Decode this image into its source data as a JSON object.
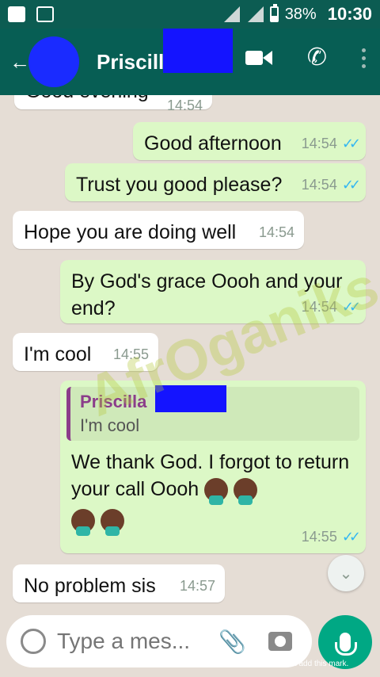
{
  "status_bar": {
    "battery": "38%",
    "time": "10:30"
  },
  "header": {
    "contact_name": "Priscilla"
  },
  "messages": [
    {
      "text": "Good evening",
      "time": "14:54"
    },
    {
      "text": "Good afternoon",
      "time": "14:54"
    },
    {
      "text": "Trust you good please?",
      "time": "14:54"
    },
    {
      "text": "Hope you are doing well",
      "time": "14:54"
    },
    {
      "text": "By God's grace Oooh and your end?",
      "time": "14:54"
    },
    {
      "text": "I'm cool",
      "time": "14:55"
    },
    {
      "quote_name": "Priscilla",
      "quote_text": "I'm cool",
      "text": "We thank God. I forgot to return your call Oooh",
      "time": "14:55"
    },
    {
      "text": "No problem sis",
      "time": "14:57"
    }
  ],
  "input": {
    "placeholder": "Type a mes..."
  },
  "watermark": "AfrOganiks",
  "footer_note": "Processed using the free version of Watermarkly. The paid version does not add this mark."
}
